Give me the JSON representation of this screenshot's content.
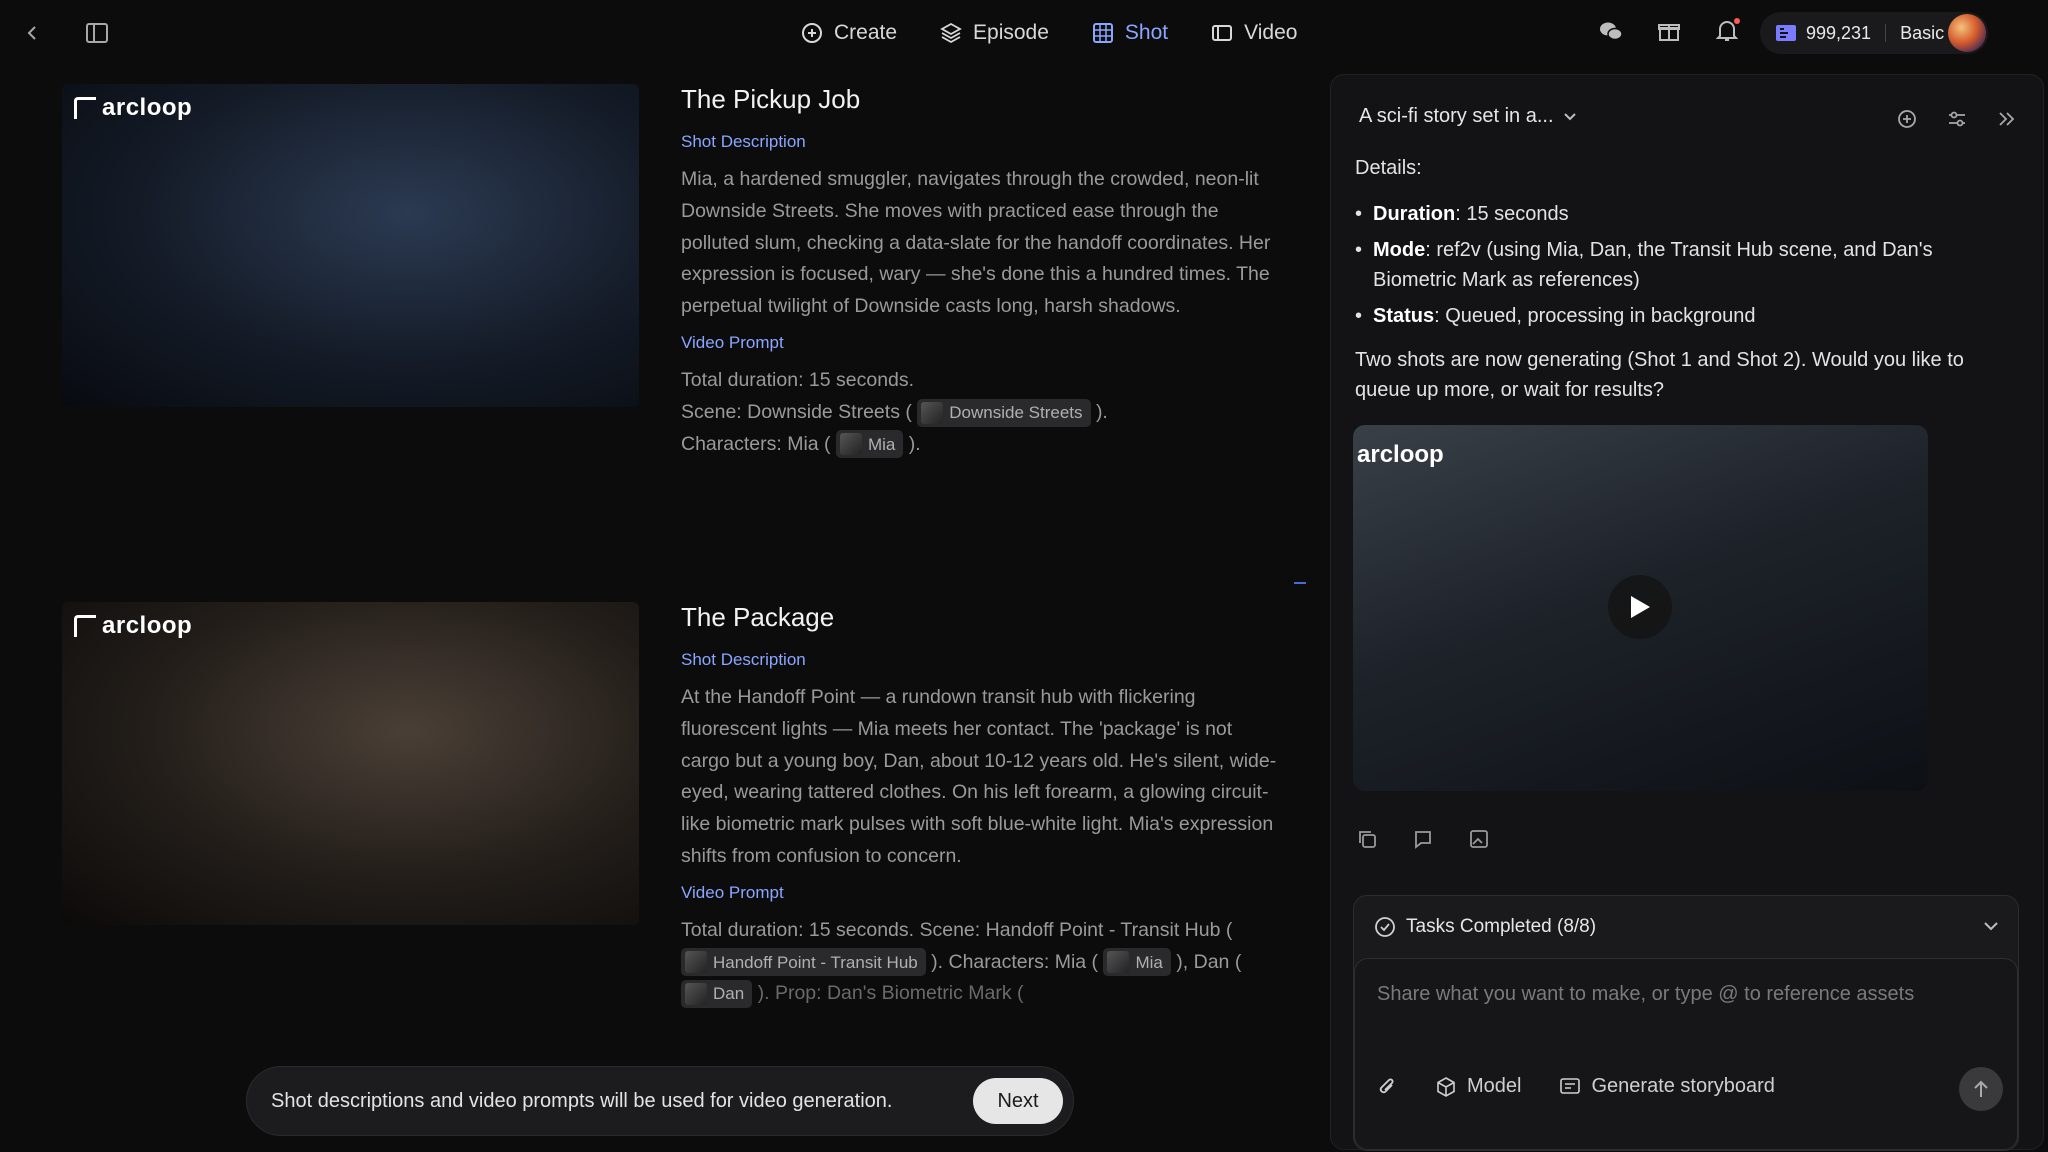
{
  "nav": {
    "items": [
      {
        "label": "Create",
        "icon": "plus-circle-icon"
      },
      {
        "label": "Episode",
        "icon": "layers-icon"
      },
      {
        "label": "Shot",
        "icon": "grid-icon"
      },
      {
        "label": "Video",
        "icon": "video-icon"
      }
    ],
    "active": "Shot"
  },
  "account": {
    "credits": "999,231",
    "plan": "Basic"
  },
  "shots": [
    {
      "logo": "arcloop",
      "title": "The Pickup Job",
      "desc_label": "Shot Description",
      "description": "Mia, a hardened smuggler, navigates through the crowded, neon-lit Downside Streets. She moves with practiced ease through the polluted slum, checking a data-slate for the handoff coordinates. Her expression is focused, wary — she's done this a hundred times. The perpetual twilight of Downside casts long, harsh shadows.",
      "prompt_label": "Video Prompt",
      "prompt_line1": "Total duration: 15 seconds.",
      "prompt_scene_prefix": "Scene: Downside Streets (",
      "scene_chip": "Downside Streets",
      "prompt_scene_suffix": ").",
      "prompt_char_prefix": "Characters: Mia (",
      "char_chip": "Mia",
      "prompt_char_suffix": ")."
    },
    {
      "logo": "arcloop",
      "title": "The Package",
      "desc_label": "Shot Description",
      "description": "At the Handoff Point — a rundown transit hub with flickering fluorescent lights — Mia meets her contact. The 'package' is not cargo but a young boy, Dan, about 10-12 years old. He's silent, wide-eyed, wearing tattered clothes. On his left forearm, a glowing circuit-like biometric mark pulses with soft blue-white light. Mia's expression shifts from confusion to concern.",
      "prompt_label": "Video Prompt",
      "prompt_a": "Total duration: 15 seconds. Scene: Handoff Point - Transit Hub (",
      "scene_chip": "Handoff Point - Transit Hub",
      "prompt_b": "). Characters: Mia (",
      "char_chip1": "Mia",
      "prompt_c": "), Dan (",
      "char_chip2": "Dan",
      "prompt_d": "). Prop: Dan's Biometric Mark ("
    }
  ],
  "toast": {
    "text": "Shot descriptions and video prompts will be used for video generation.",
    "button": "Next"
  },
  "panel": {
    "title": "A sci-fi story set in a...",
    "details_label": "Details:",
    "details": [
      {
        "key": "Duration",
        "value": ": 15 seconds"
      },
      {
        "key": "Mode",
        "value": ": ref2v (using Mia, Dan, the Transit Hub scene, and Dan's Biometric Mark as references)"
      },
      {
        "key": "Status",
        "value": ": Queued, processing in background"
      }
    ],
    "message": "Two shots are now generating (Shot 1 and Shot 2). Would you like to queue up more, or wait for results?",
    "video_logo": "arcloop",
    "tasks_label": "Tasks Completed (8/8)",
    "input_placeholder": "Share what you want to make, or type @ to reference assets",
    "tool_model": "Model",
    "tool_storyboard": "Generate storyboard"
  }
}
